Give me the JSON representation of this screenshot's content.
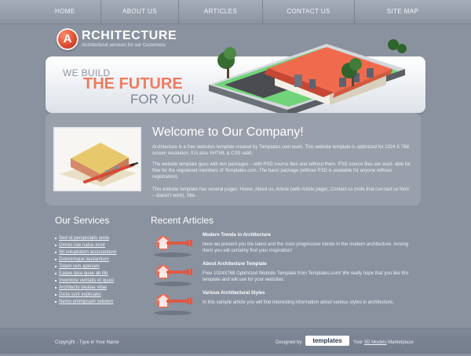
{
  "nav": [
    {
      "label": "HOME"
    },
    {
      "label": "ABOUT US"
    },
    {
      "label": "ARTICLES"
    },
    {
      "label": "CONTACT US"
    },
    {
      "label": "SITE MAP"
    }
  ],
  "brand": {
    "badge_letter": "A",
    "title": "RCHITECTURE",
    "tagline": "Architectural services for our Customers"
  },
  "hero": {
    "line1": "WE BUILD",
    "line2": "THE FUTURE",
    "line3": "FOR YOU!"
  },
  "welcome": {
    "title": "Welcome to Our Company!",
    "paragraphs": [
      "Architecture is a free websites template created by Templates.com team. This website template is optimized for 1024 X 768 screen resolution. It is also XHTML & CSS valid.",
      "The website template goes with two packages – with PSD source files and without them. PSD source files are avail- able for free for the registered members of Templates.com. The basic package (without PSD is available for anyone without registration).",
      "This website template has several pages: Home, About us, Article (with Article page), Contact us (note that con-tact us form – doesn't work), Site."
    ]
  },
  "services": {
    "title": "Our Services",
    "items": [
      "Sed ut perspiciatis unde",
      "Omnis iste natus error",
      "Sit voluptatem accusantium",
      "Doloremque laudantium",
      "Totam rem aperiam",
      "Eaque ipsa quae ab illo",
      "Inventore veritatis et quasi",
      "Architecto beatae vitae",
      "Dicta sunt explicabo",
      "Nemo enimipsam volutem"
    ]
  },
  "articles": {
    "title": "Recent Articles",
    "items": [
      {
        "heading": "Modern Trends in Architecture",
        "text": "Here we present you the latest and the most progressive trends in the modern architecture. Among them you will certainly find your inspiration!"
      },
      {
        "heading": "About Architecture Template",
        "text": "Free 1024X768 Optimized Website Template from Templates.com! We really hope that you like this template and will use for your websites."
      },
      {
        "heading": "Various Architectural Styles",
        "text": "In this sample article you will find interesting information about various styles in architecture."
      }
    ]
  },
  "footer": {
    "copyright": "Copyright - Type in Your Name",
    "designed_by": "Designed by:",
    "logo_text": "templates",
    "marketplace_prefix": "Your",
    "marketplace_link": "3D Models",
    "marketplace_suffix": "Marketplace"
  }
}
